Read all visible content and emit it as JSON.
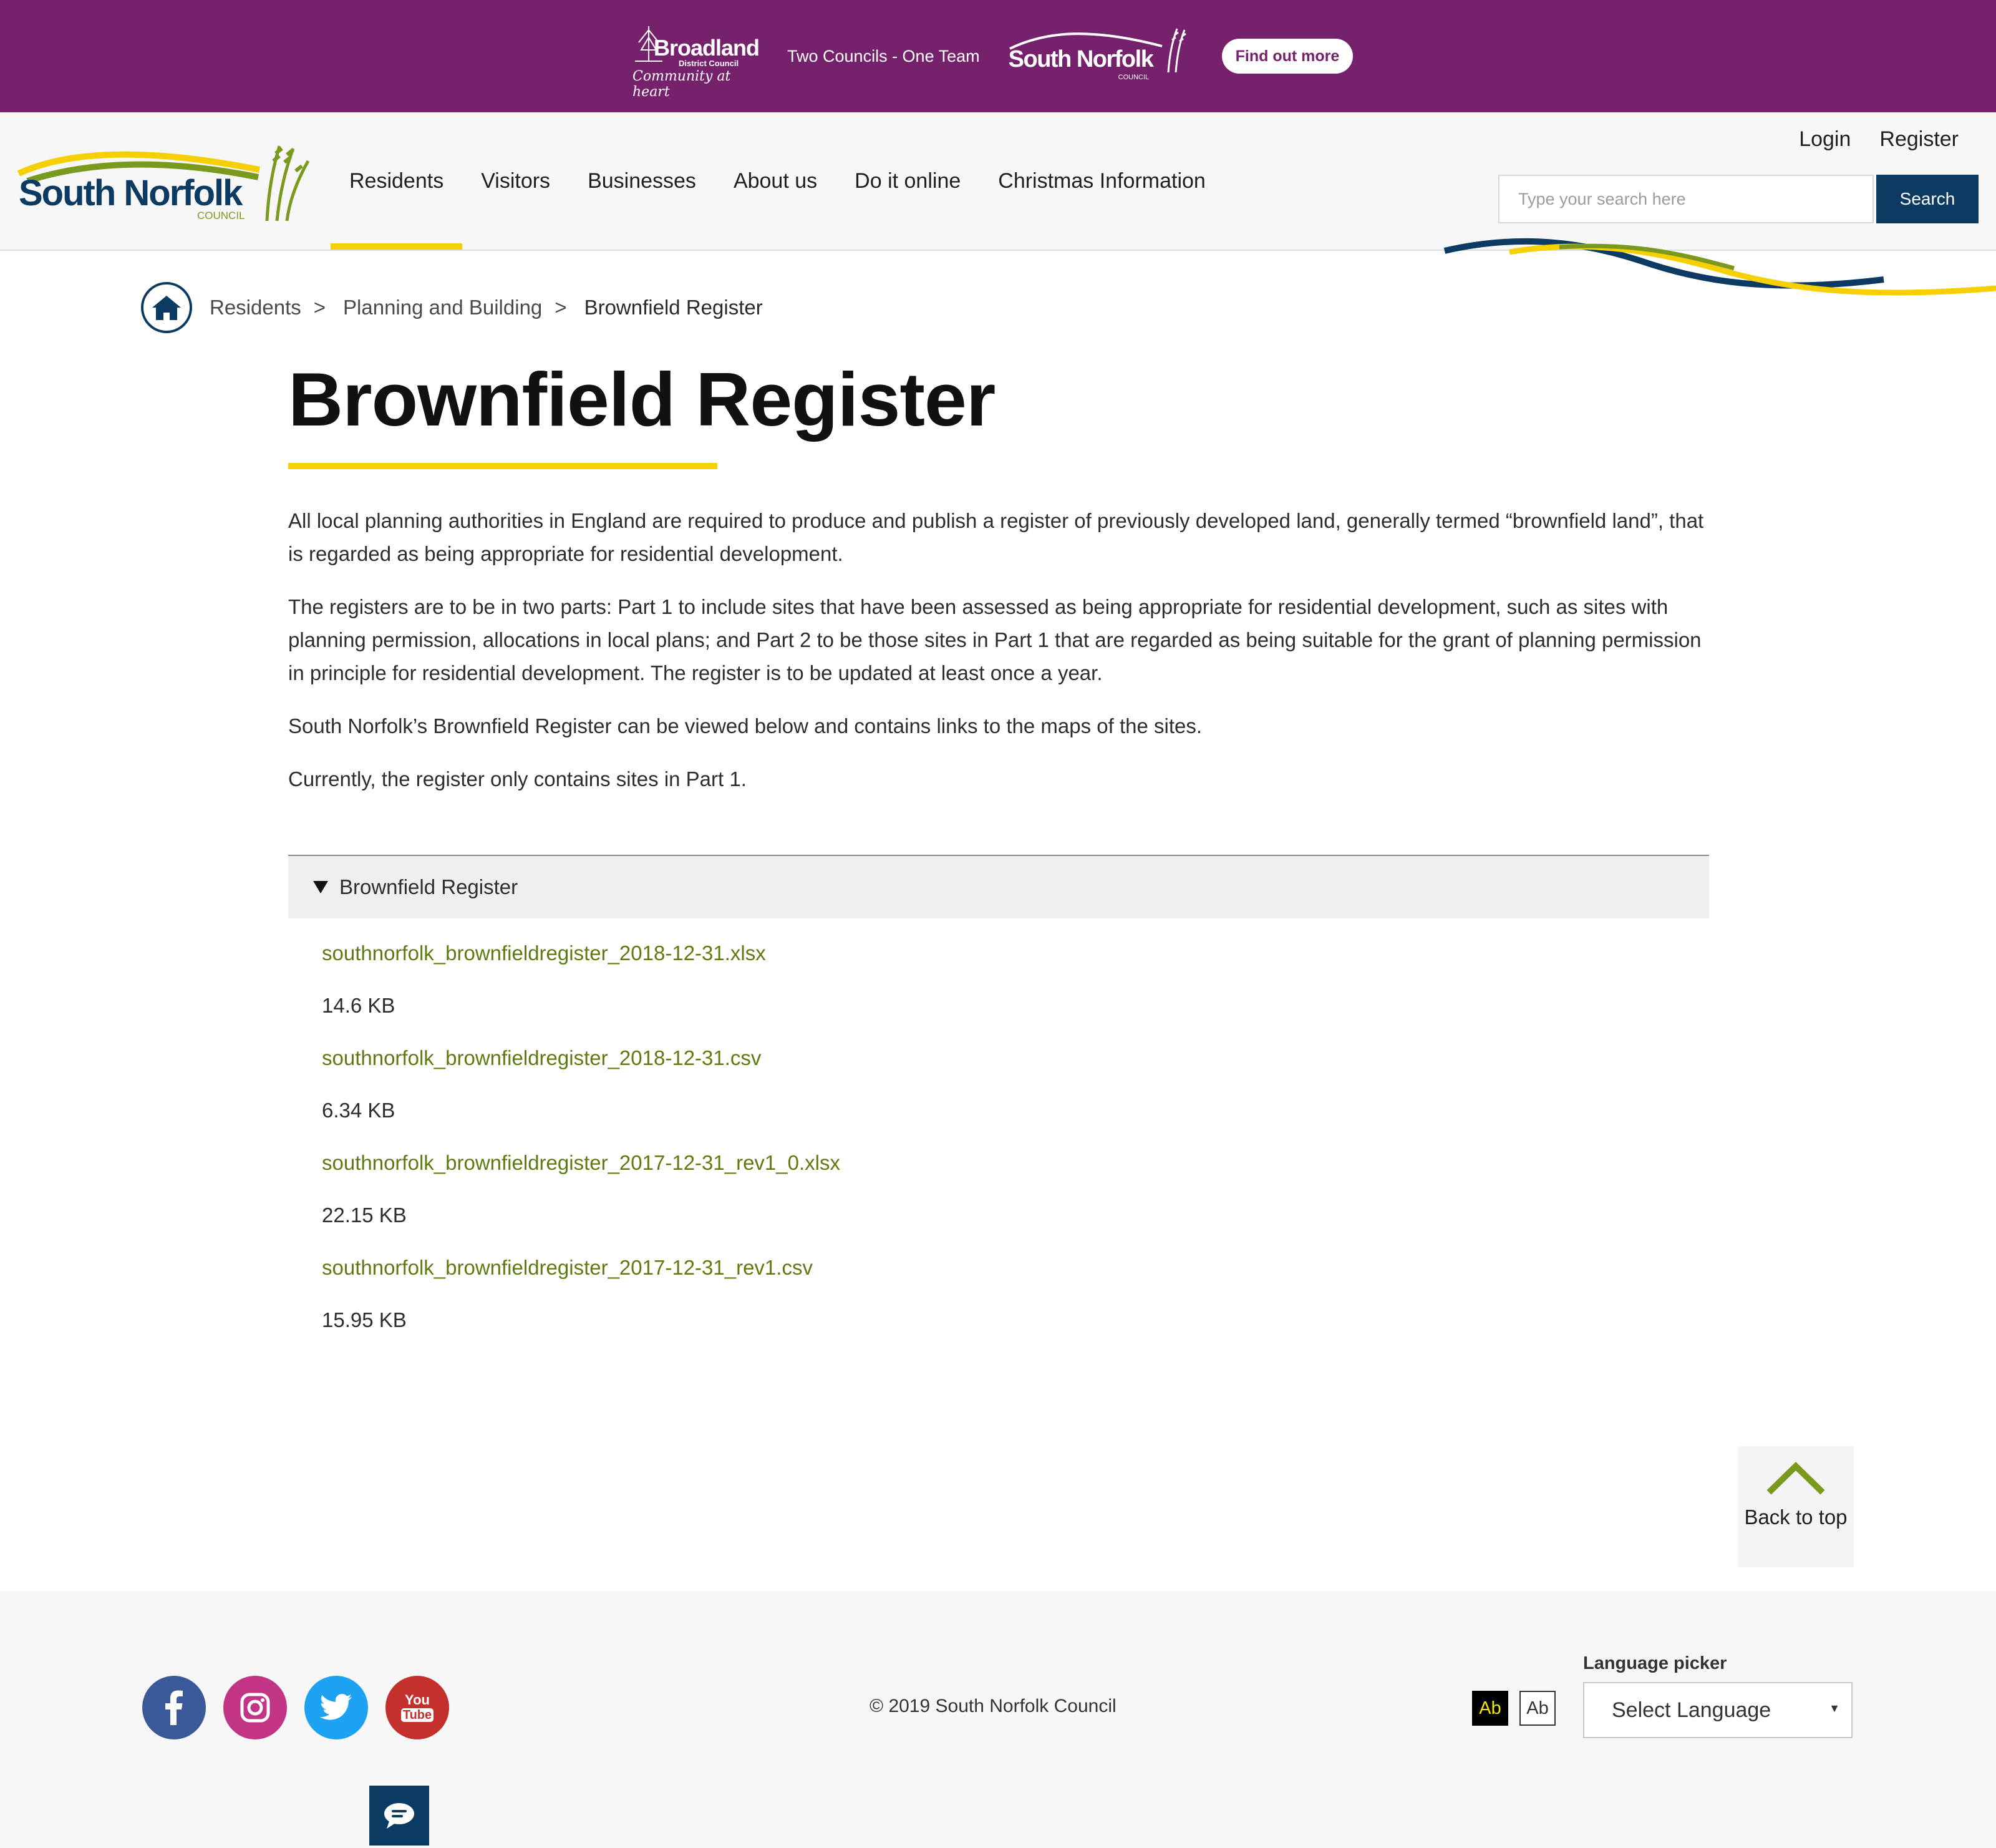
{
  "promo": {
    "broadland_name": "Broadland",
    "broadland_sub": "District Council",
    "broadland_tagline": "Community at heart",
    "tagline": "Two Councils - One Team",
    "south_norfolk_name": "South Norfolk",
    "south_norfolk_sub": "COUNCIL",
    "cta_label": "Find out more"
  },
  "header": {
    "logo_name": "South Norfolk",
    "logo_sub": "COUNCIL",
    "nav": [
      {
        "label": "Residents",
        "active": true
      },
      {
        "label": "Visitors"
      },
      {
        "label": "Businesses"
      },
      {
        "label": "About us"
      },
      {
        "label": "Do it online"
      },
      {
        "label": "Christmas Information"
      }
    ],
    "login_label": "Login",
    "register_label": "Register",
    "search_placeholder": "Type your search here",
    "search_button": "Search"
  },
  "breadcrumb": {
    "home_icon": "home-icon",
    "items": [
      "Residents",
      "Planning and Building",
      "Brownfield Register"
    ],
    "separator": ">"
  },
  "main": {
    "title": "Brownfield Register",
    "paragraphs": [
      "All local planning authorities in England are required to produce and publish a register of previously developed land, generally termed “brownfield land”, that is regarded as being appropriate for residential development.",
      "The registers are to be in two parts: Part 1 to include sites that have been assessed as being appropriate for residential development, such as sites with planning permission, allocations in local plans; and Part 2 to be those sites in Part 1 that are regarded as being suitable for the grant of planning permission in principle for residential development. The register is to be updated at least once a year.",
      "South Norfolk’s Brownfield Register can be viewed below and contains links to the maps of the sites.",
      "Currently, the register only contains sites in Part 1."
    ],
    "accordion": {
      "summary": "Brownfield Register",
      "files": [
        {
          "name": "southnorfolk_brownfieldregister_2018-12-31.xlsx",
          "size": "14.6 KB"
        },
        {
          "name": "southnorfolk_brownfieldregister_2018-12-31.csv",
          "size": "6.34 KB"
        },
        {
          "name": "southnorfolk_brownfieldregister_2017-12-31_rev1_0.xlsx",
          "size": "22.15 KB"
        },
        {
          "name": "southnorfolk_brownfieldregister_2017-12-31_rev1.csv",
          "size": "15.95 KB"
        }
      ]
    }
  },
  "back_to_top": {
    "label": "Back to top",
    "icon": "chevron-up-icon"
  },
  "footer": {
    "social": [
      {
        "name": "facebook",
        "icon": "facebook-icon",
        "color": "#3b5998"
      },
      {
        "name": "instagram",
        "icon": "instagram-icon",
        "color": "#c13584"
      },
      {
        "name": "twitter",
        "icon": "twitter-icon",
        "color": "#1da1f2"
      },
      {
        "name": "youtube",
        "icon": "youtube-icon",
        "color": "#c4302b",
        "text_top": "You",
        "text_bottom": "Tube"
      }
    ],
    "copyright": "© 2019 South Norfolk Council",
    "contrast_dark": "Ab",
    "contrast_light": "Ab",
    "language_label": "Language picker",
    "language_select": "Select Language",
    "chat_icon": "chat-icon"
  },
  "colors": {
    "promo_purple": "#76216c",
    "navy": "#0b3a62",
    "yellow": "#f5cf00",
    "link_green": "#5e7a10"
  }
}
